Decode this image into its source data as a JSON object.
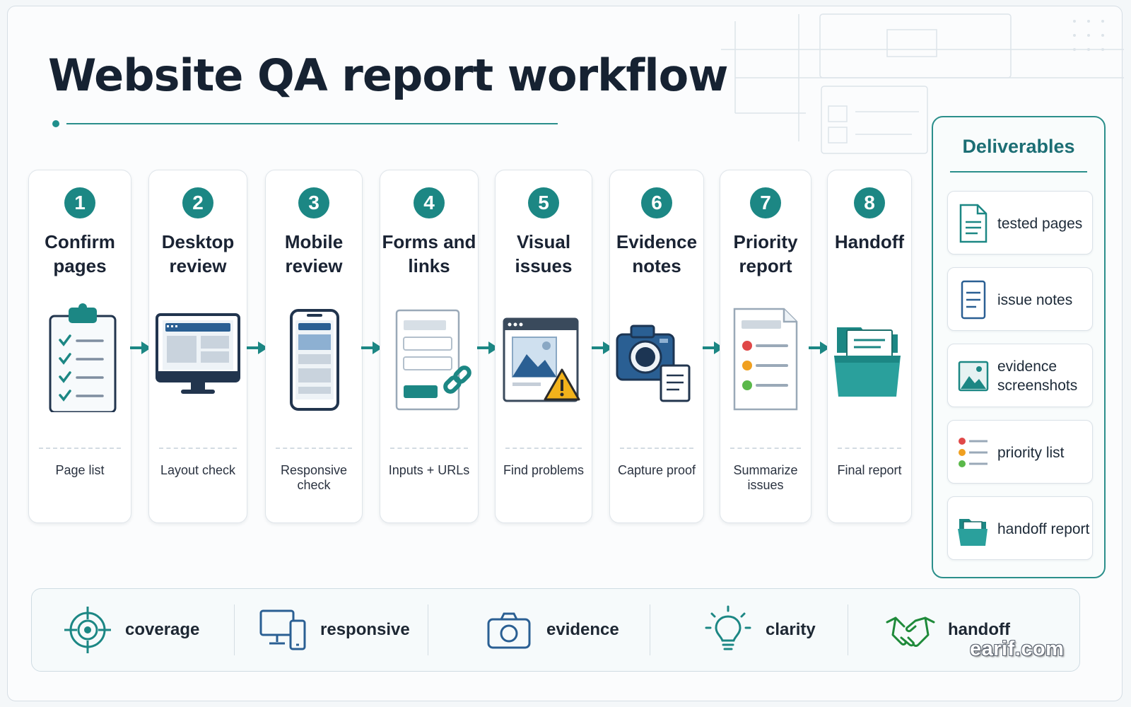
{
  "header": {
    "title": "Website QA report workflow"
  },
  "steps": [
    {
      "number": "1",
      "title": "Confirm pages",
      "note": "Page list",
      "icon": "clipboard-checklist-icon"
    },
    {
      "number": "2",
      "title": "Desktop review",
      "note": "Layout check",
      "icon": "desktop-monitor-icon"
    },
    {
      "number": "3",
      "title": "Mobile review",
      "note": "Responsive check",
      "icon": "mobile-phone-icon"
    },
    {
      "number": "4",
      "title": "Forms and links",
      "note": "Inputs + URLs",
      "icon": "form-link-icon"
    },
    {
      "number": "5",
      "title": "Visual issues",
      "note": "Find problems",
      "icon": "image-warning-icon"
    },
    {
      "number": "6",
      "title": "Evidence notes",
      "note": "Capture proof",
      "icon": "camera-notes-icon"
    },
    {
      "number": "7",
      "title": "Priority report",
      "note": "Summarize issues",
      "icon": "priority-report-icon"
    },
    {
      "number": "8",
      "title": "Handoff",
      "note": "Final report",
      "icon": "folder-icon"
    }
  ],
  "deliverables": {
    "title": "Deliverables",
    "items": [
      {
        "label": "tested pages",
        "icon": "document-icon"
      },
      {
        "label": "issue notes",
        "icon": "notes-icon"
      },
      {
        "label": "evidence screenshots",
        "icon": "screenshot-icon"
      },
      {
        "label": "priority list",
        "icon": "priority-list-icon"
      },
      {
        "label": "handoff report",
        "icon": "folder-icon"
      }
    ]
  },
  "benefits": [
    {
      "label": "coverage",
      "icon": "target-icon"
    },
    {
      "label": "responsive",
      "icon": "devices-icon"
    },
    {
      "label": "evidence",
      "icon": "camera-icon"
    },
    {
      "label": "clarity",
      "icon": "lightbulb-icon"
    },
    {
      "label": "handoff",
      "icon": "handshake-icon"
    }
  ],
  "colors": {
    "accent": "#1c8784",
    "blue": "#2a5f93",
    "priority_high": "#e04848",
    "priority_medium": "#f0a020",
    "priority_low": "#5ab84a",
    "warning": "#f2b21b"
  },
  "watermark": "earif.com"
}
